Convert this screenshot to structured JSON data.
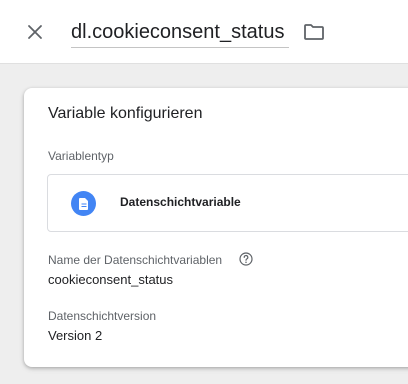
{
  "header": {
    "variable_name": "dl.cookieconsent_status",
    "close_icon": "close-icon",
    "folder_icon": "folder-icon"
  },
  "card": {
    "title": "Variable konfigurieren",
    "type_section": {
      "label": "Variablentyp",
      "selected_type": "Datenschichtvariable",
      "icon": "document-icon",
      "icon_color": "#4285f4"
    },
    "name_field": {
      "label": "Name der Datenschichtvariablen",
      "value": "cookieconsent_status",
      "help_icon": "help-icon"
    },
    "version_field": {
      "label": "Datenschichtversion",
      "value": "Version 2"
    }
  }
}
